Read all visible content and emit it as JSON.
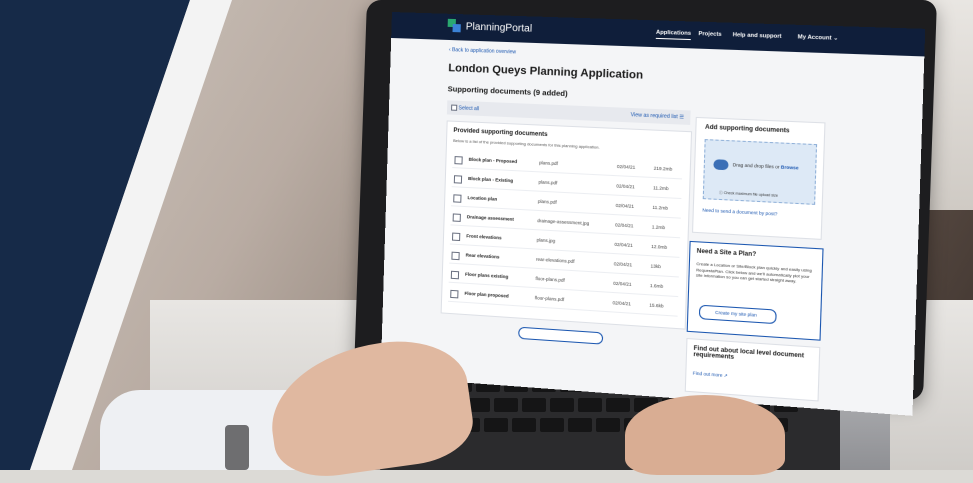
{
  "app": {
    "name": "PlanningPortal"
  },
  "nav": [
    "Applications",
    "Projects",
    "Help and support",
    "My Account"
  ],
  "back_link": "Back to application overview",
  "page_title": "London Queys Planning Application",
  "section_title": "Supporting documents (9 added)",
  "select_all": "Select all",
  "view_list": "View as required list",
  "provided": {
    "title": "Provided supporting documents",
    "desc": "Below is a list of the provided supporting documents for this planning application.",
    "rows": [
      {
        "name": "Block plan - Proposed",
        "file": "plans.pdf",
        "date": "02/04/21",
        "size": "219.2mb"
      },
      {
        "name": "Block plan - Existing",
        "file": "plans.pdf",
        "date": "02/04/21",
        "size": "11.2mb"
      },
      {
        "name": "Location plan",
        "file": "plans.pdf",
        "date": "02/04/21",
        "size": "11.2mb"
      },
      {
        "name": "Drainage assessment",
        "file": "drainage-assessment.jpg",
        "date": "02/04/21",
        "size": "1.2mb"
      },
      {
        "name": "Front elevations",
        "file": "plans.jpg",
        "date": "02/04/21",
        "size": "12.0mb"
      },
      {
        "name": "Rear elevations",
        "file": "rear-elevations.pdf",
        "date": "02/04/21",
        "size": "13kb"
      },
      {
        "name": "Floor plans existing",
        "file": "floor-plans.pdf",
        "date": "02/04/21",
        "size": "1.6mb"
      },
      {
        "name": "Floor plan proposed",
        "file": "floor-plans.pdf",
        "date": "02/04/21",
        "size": "15.6kb"
      }
    ]
  },
  "add_docs": {
    "title": "Add supporting documents",
    "drop_text": "Drag and drop files or",
    "browse": "Browse",
    "hint": "Check maximum file upload size",
    "post_link": "Need to send a document by post?"
  },
  "site_plan": {
    "title": "Need a Site a Plan?",
    "text": "Create a Location or Site/Block plan quickly and easily using RequestaPlan. Click below and we'll automatically plot your site information so you can get started straight away.",
    "button": "Create my site plan"
  },
  "local": {
    "title": "Find out about local level document requirements",
    "link": "Find out more"
  },
  "colors": {
    "navy": "#162a48",
    "link": "#1a56b0"
  },
  "icons": [
    "chevron-left-icon",
    "list-icon",
    "cloud-upload-icon",
    "info-icon",
    "external-link-icon",
    "chevron-down-icon"
  ]
}
